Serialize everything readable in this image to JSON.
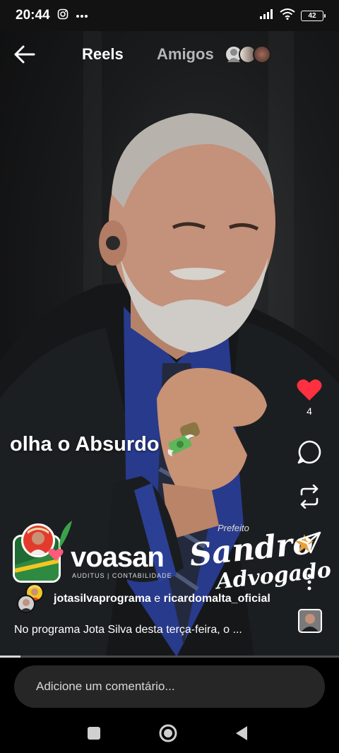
{
  "status_bar": {
    "time": "20:44",
    "battery": "42",
    "icons": [
      "instagram-notification-icon",
      "more-notifications-icon",
      "signal-icon",
      "wifi-icon",
      "battery-icon"
    ]
  },
  "nav": {
    "back_icon": "arrow-left-icon",
    "tab_reels": "Reels",
    "tab_amigos": "Amigos"
  },
  "overlay": {
    "caption": "olha o Absurdo",
    "emoji": "money-with-wings-icon"
  },
  "logos": {
    "voasan": "voasan",
    "voasan_sub": "AUDITUS | CONTABILIDADE",
    "prefeito": "Prefeito",
    "sandro": "Sandro",
    "advogado": "Advogado"
  },
  "actions": {
    "like_count": "4",
    "like_color": "#ff3040",
    "icons": [
      "heart-icon",
      "comment-icon",
      "repost-icon",
      "share-icon",
      "more-icon"
    ]
  },
  "post": {
    "author1": "jotasilvaprograma",
    "conj": "e",
    "author2": "ricardomalta_oficial",
    "description": "No programa Jota Silva desta terça-feira, o ..."
  },
  "progress": 0.06,
  "comment": {
    "placeholder": "Adicione um comentário..."
  },
  "android_nav": {
    "icons": [
      "recents-square-icon",
      "home-circle-icon",
      "back-triangle-icon"
    ]
  }
}
